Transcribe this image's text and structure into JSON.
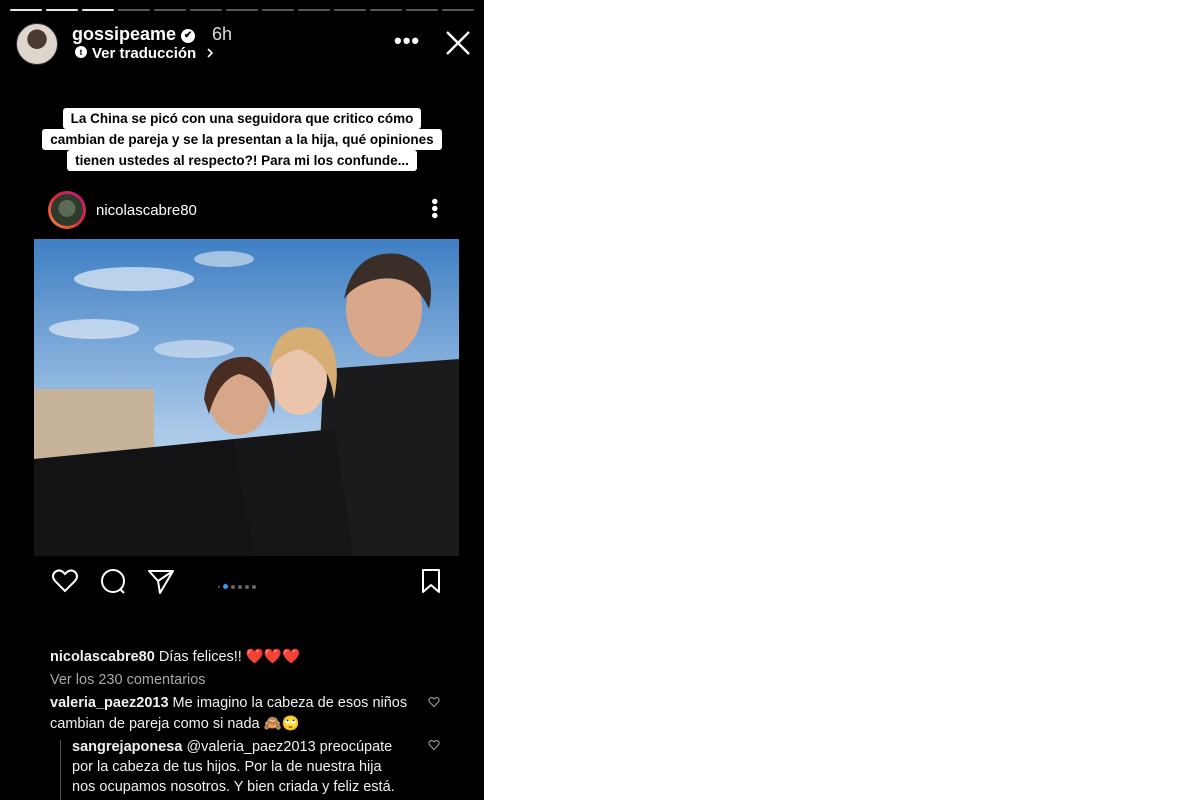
{
  "story": {
    "username": "gossipeame",
    "time": "6h",
    "translate": "Ver traducción",
    "progress_total": 13,
    "progress_done": 3
  },
  "caption": {
    "lines": [
      "La China se picó con una seguidora que critico cómo",
      "cambian de pareja y se la presentan a la hija, qué opiniones",
      "tienen ustedes al respecto?! Para mi los confunde..."
    ]
  },
  "post": {
    "username": "nicolascabre80",
    "caption_user": "nicolascabre80",
    "caption_text": "Días felices!! ❤️❤️❤️",
    "view_comments": "Ver los 230 comentarios",
    "carousel_count": 6,
    "carousel_active": 1
  },
  "comments": [
    {
      "user": "valeria_paez2013",
      "line1": "Me imagino la cabeza de esos niños",
      "line2": "cambian de pareja como si nada 🙈🙄"
    },
    {
      "user": "sangrejaponesa",
      "line1": "@valeria_paez2013 preocúpate",
      "line2": "por la cabeza de tus hijos. Por la de nuestra hija",
      "line3": "nos ocupamos nosotros. Y bien criada y feliz está."
    }
  ],
  "colors": {
    "background": "#000000",
    "text": "#ffffff",
    "caption_box": "#ffffff",
    "carousel_active": "#3897f0",
    "heart": "#e0245e"
  },
  "icons": [
    "verified-icon",
    "chevron-right-icon",
    "more-icon",
    "close-icon",
    "like-icon",
    "comment-icon",
    "share-icon",
    "save-icon"
  ]
}
